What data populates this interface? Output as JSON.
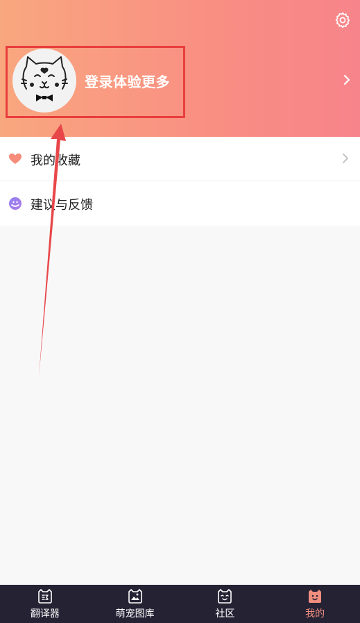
{
  "header": {
    "login_prompt": "登录体验更多"
  },
  "colors": {
    "header_gradient_start": "#f9a77f",
    "header_gradient_end": "#f7848a",
    "annotation_red": "#e83d3d",
    "tabbar_bg": "#252234",
    "tab_active": "#f08e7e"
  },
  "icons": {
    "settings": "gear-icon",
    "avatar": "cat-avatar-icon",
    "profile_chevron": "chevron-right-icon"
  },
  "menu": {
    "items": [
      {
        "label": "我的收藏",
        "icon": "heart-icon",
        "has_chevron": true
      },
      {
        "label": "建议与反馈",
        "icon": "feedback-icon",
        "has_chevron": false
      }
    ]
  },
  "tabbar": {
    "tabs": [
      {
        "label": "翻译器",
        "icon": "translate-icon",
        "active": false
      },
      {
        "label": "萌宠图库",
        "icon": "gallery-icon",
        "active": false
      },
      {
        "label": "社区",
        "icon": "community-cat-icon",
        "active": false
      },
      {
        "label": "我的",
        "icon": "me-cat-icon",
        "active": true
      }
    ]
  }
}
